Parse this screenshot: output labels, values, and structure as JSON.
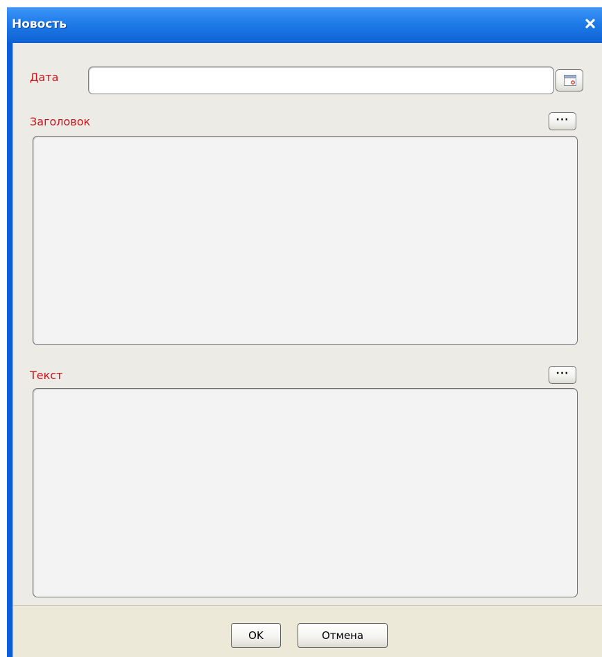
{
  "window": {
    "title": "Новость",
    "close_icon": "close-icon"
  },
  "form": {
    "date": {
      "label": "Дата",
      "value": "",
      "icon": "calendar-icon"
    },
    "heading": {
      "label": "Заголовок",
      "more_label": "···",
      "value": ""
    },
    "text": {
      "label": "Текст",
      "more_label": "···",
      "value": ""
    }
  },
  "buttons": {
    "ok": "OK",
    "cancel": "Отмена"
  },
  "colors": {
    "title_bar": "#0f62d4",
    "label": "#c8141b",
    "background": "#ecebe5"
  }
}
